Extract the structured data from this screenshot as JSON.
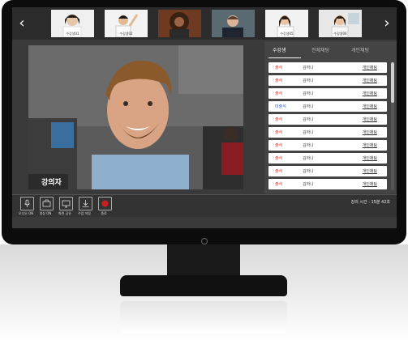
{
  "topbar": {
    "prev_arrow": "‹",
    "next_arrow": "›",
    "thumbnails": [
      {
        "label": "수강생01"
      },
      {
        "label": "수강생02"
      },
      {
        "label": "수강생03"
      },
      {
        "label": "수강생04"
      },
      {
        "label": "수강생05"
      },
      {
        "label": "수강생06"
      }
    ]
  },
  "main_video": {
    "speaker_label": "강의자"
  },
  "side_panel": {
    "tabs": [
      "수강생",
      "전체채팅",
      "개인채팅"
    ],
    "active_tab": "수강생",
    "students": [
      {
        "status": "출석",
        "status_color": "#e0302a",
        "name": "김하나",
        "chat": "개인채팅"
      },
      {
        "status": "출석",
        "status_color": "#e0302a",
        "name": "김하나",
        "chat": "개인채팅"
      },
      {
        "status": "출석",
        "status_color": "#e0302a",
        "name": "김하나",
        "chat": "개인채팅"
      },
      {
        "status": "미출석",
        "status_color": "#2f5fd0",
        "name": "김하나",
        "chat": "개인채팅"
      },
      {
        "status": "출석",
        "status_color": "#e0302a",
        "name": "김하나",
        "chat": "개인채팅"
      },
      {
        "status": "출석",
        "status_color": "#e0302a",
        "name": "김하나",
        "chat": "개인채팅"
      },
      {
        "status": "출석",
        "status_color": "#e0302a",
        "name": "김하나",
        "chat": "개인채팅"
      },
      {
        "status": "출석",
        "status_color": "#e0302a",
        "name": "김하나",
        "chat": "개인채팅"
      },
      {
        "status": "출석",
        "status_color": "#e0302a",
        "name": "김하나",
        "chat": "개인채팅"
      },
      {
        "status": "출석",
        "status_color": "#e0302a",
        "name": "김하나",
        "chat": "개인채팅"
      }
    ]
  },
  "controls": [
    {
      "label": "오디오 ON",
      "icon": "microphone-icon"
    },
    {
      "label": "영상 ON",
      "icon": "camera-icon"
    },
    {
      "label": "화면 공유",
      "icon": "screen-share-icon"
    },
    {
      "label": "수업 저장",
      "icon": "download-icon"
    },
    {
      "label": "종료",
      "icon": "stop-icon"
    }
  ],
  "timer": "강의 시간 : 15분 42초",
  "colors": {
    "screen_bg": "#3a3a3a",
    "attended": "#e0302a",
    "absent": "#2f5fd0"
  }
}
